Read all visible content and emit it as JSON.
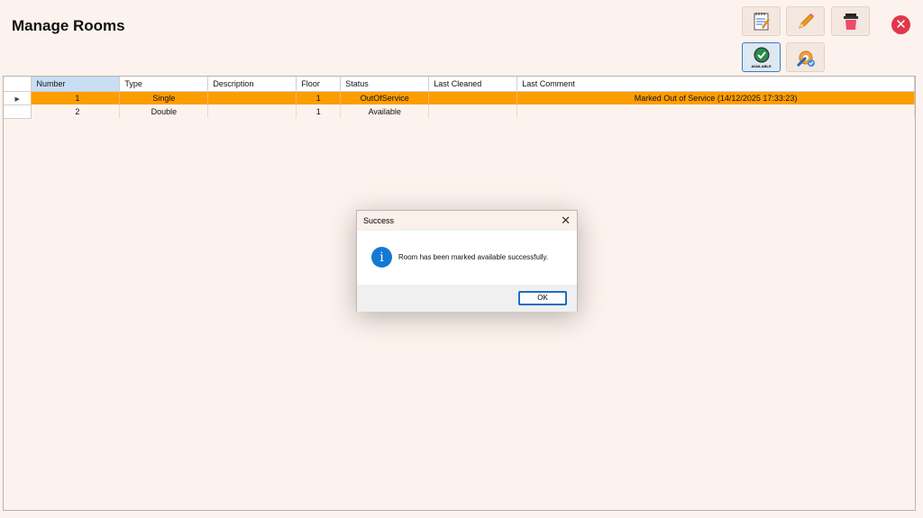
{
  "header": {
    "title": "Manage Rooms"
  },
  "toolbar": {
    "available_label": "AVAILABLE",
    "accent_color": "#3a7bc2",
    "close_color": "#e2364b"
  },
  "grid": {
    "columns": [
      "Number",
      "Type",
      "Description",
      "Floor",
      "Status",
      "Last Cleaned",
      "Last Comment"
    ],
    "rows": [
      {
        "number": "1",
        "type": "Single",
        "description": "",
        "floor": "1",
        "status": "OutOfService",
        "last_cleaned": "",
        "last_comment": "Marked Out of Service (14/12/2025 17:33:23)"
      },
      {
        "number": "2",
        "type": "Double",
        "description": "",
        "floor": "1",
        "status": "Available",
        "last_cleaned": "",
        "last_comment": ""
      }
    ],
    "selected_row_color": "#fe9d02"
  },
  "dialog": {
    "title": "Success",
    "message": "Room has been marked available successfully.",
    "ok_label": "OK"
  }
}
